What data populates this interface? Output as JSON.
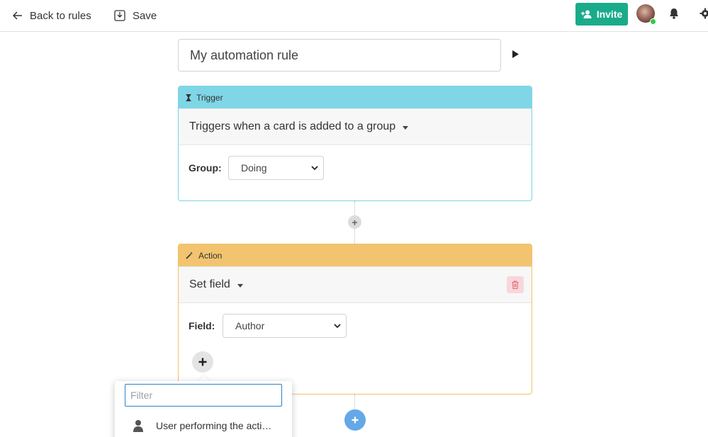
{
  "topbar": {
    "back_label": "Back to rules",
    "save_label": "Save",
    "invite_label": "Invite"
  },
  "rule": {
    "name": "My automation rule"
  },
  "trigger": {
    "header": "Trigger",
    "description": "Triggers when a card is added to a group",
    "field_label": "Group:",
    "field_value": "Doing"
  },
  "action": {
    "header": "Action",
    "description": "Set field",
    "field_label": "Field:",
    "field_value": "Author"
  },
  "popup": {
    "filter_placeholder": "Filter",
    "items": [
      {
        "label": "User performing the acti…",
        "icon": "user-icon"
      }
    ]
  },
  "colors": {
    "invite": "#1aab8a",
    "trigger_header": "#7fd6e6",
    "action_header": "#f2c46f",
    "add_blue": "#64a8e8",
    "delete_bg": "#f8d7da"
  }
}
